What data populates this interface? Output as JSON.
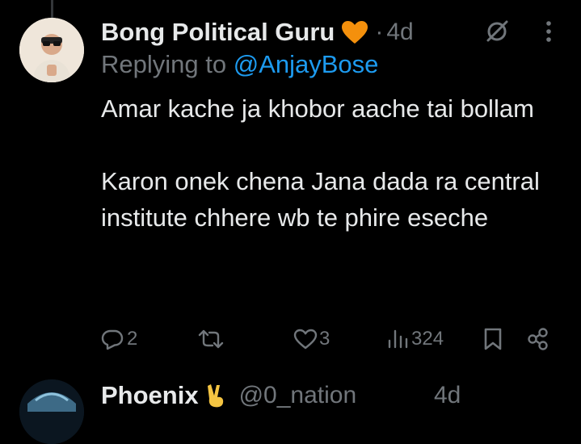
{
  "tweet": {
    "author_name": "Bong Political Guru",
    "badge_icon": "orange-heart-icon",
    "separator": "·",
    "time": "4d",
    "replying_prefix": "Replying to",
    "replying_handle": "@AnjayBose",
    "paragraphs": [
      "Amar kache ja khobor aache tai bollam",
      "Karon onek chena Jana dada ra central institute chhere wb te phire eseche"
    ],
    "actions": {
      "reply_count": "2",
      "retweet_count": "",
      "like_count": "3",
      "view_count": "324"
    }
  },
  "next_tweet": {
    "author_name": "Phoenix",
    "badge_icon": "victory-hand-icon",
    "handle": "@0_nation",
    "time": "4d"
  },
  "colors": {
    "background": "#000000",
    "text": "#e7e9ea",
    "muted": "#71767b",
    "link": "#1d9bf0",
    "heart": "#f4900c"
  }
}
